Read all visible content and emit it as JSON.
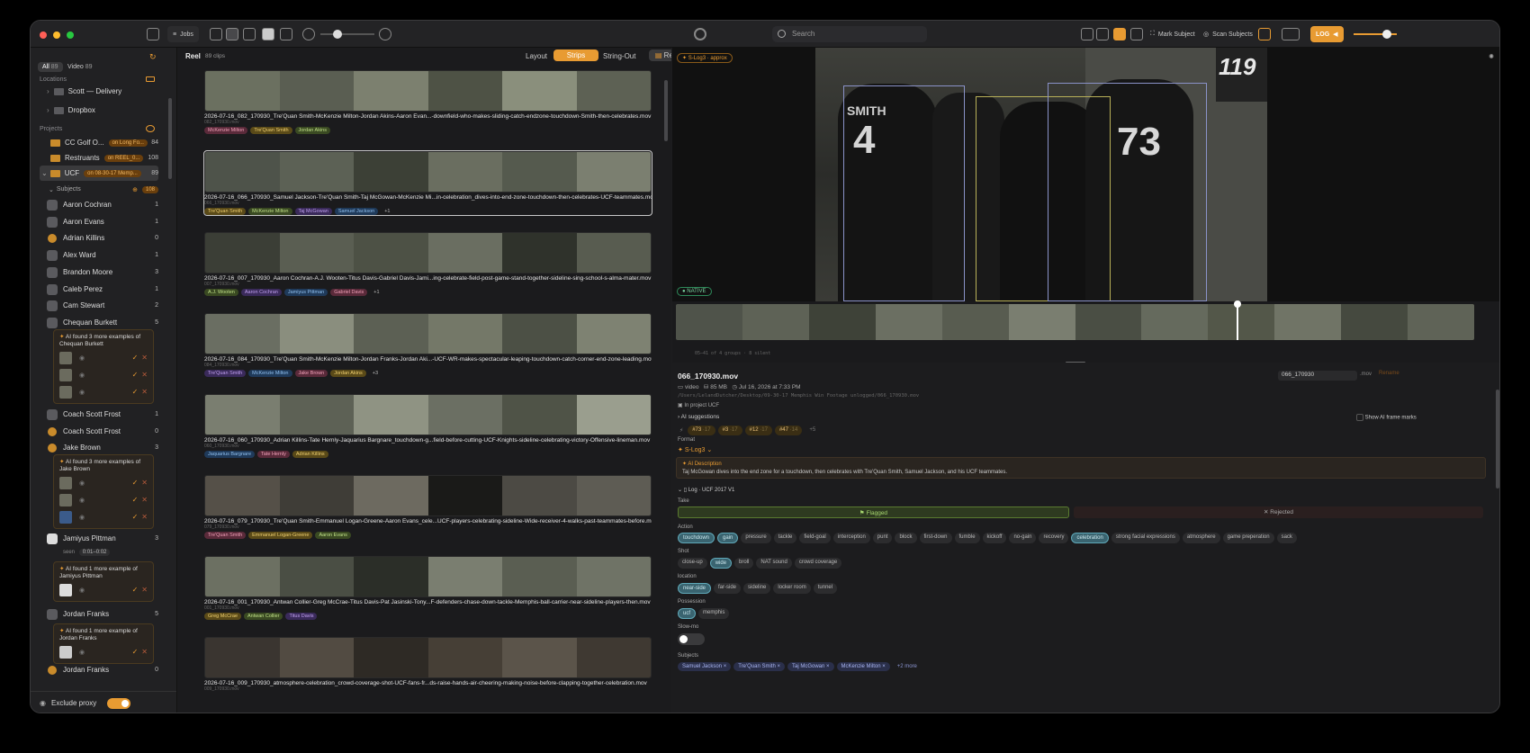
{
  "colors": {
    "accent": "#e89b32",
    "window_bg": "#1c1c1e",
    "sidebar_bg": "#212123",
    "selection_teal": "#3a6470"
  },
  "toolbar": {
    "jobs_label": "Jobs",
    "search_placeholder": "Search",
    "mark_subject_label": "Mark Subject",
    "scan_subjects_label": "Scan Subjects",
    "log_badge": "LOG",
    "icons": [
      "sidebar-toggle-icon",
      "jobs-icon",
      "grid-view-icon",
      "strip-view-icon",
      "doc-view-icon",
      "copy-icon",
      "clone-icon",
      "zoom-slider",
      "crosshair-icon",
      "search-icon",
      "monitor-icon",
      "loop-icon",
      "magic-icon",
      "wand-icon",
      "sort-icon",
      "keyboard-icon",
      "volume-icon"
    ]
  },
  "sidebar": {
    "filter_all": "All",
    "filter_all_count": "89",
    "filter_video": "Video",
    "filter_video_count": "89",
    "locations_title": "Locations",
    "locations": [
      {
        "label": "Scott — Delivery"
      },
      {
        "label": "Dropbox"
      }
    ],
    "projects_title": "Projects",
    "projects": [
      {
        "label": "CC Golf O...",
        "tag": "on Long Fo...",
        "count": "84"
      },
      {
        "label": "Restruants",
        "tag": "on REEL_0...",
        "count": "108"
      },
      {
        "label": "UCF",
        "tag": "on 08-30-17 Memp...",
        "count": "89"
      }
    ],
    "subjects_title": "Subjects",
    "subjects_count": "108",
    "subjects": [
      {
        "label": "Aaron Cochran",
        "count": "1"
      },
      {
        "label": "Aaron Evans",
        "count": "1"
      },
      {
        "label": "Adrian Killins",
        "count": "0"
      },
      {
        "label": "Alex Ward",
        "count": "1"
      },
      {
        "label": "Brandon Moore",
        "count": "3"
      },
      {
        "label": "Caleb Perez",
        "count": "1"
      },
      {
        "label": "Cam Stewart",
        "count": "2"
      },
      {
        "label": "Chequan Burkett",
        "count": "5"
      }
    ],
    "ai_chequan": "AI found 3 more examples of Chequan Burkett",
    "subjects2": [
      {
        "label": "Coach Scott Frost",
        "count": "1"
      },
      {
        "label": "Coach Scott Frost",
        "count": "0"
      },
      {
        "label": "Jake Brown",
        "count": "3"
      }
    ],
    "ai_jake": "AI found 3 more examples of Jake Brown",
    "jamiyus": {
      "label": "Jamiyus Pittman",
      "count": "3",
      "seen_label": "seen",
      "seen_value": "0:01–0:02"
    },
    "ai_jamiyus": "AI found 1 more example of Jamiyus Pittman",
    "jordan": {
      "label": "Jordan Franks",
      "count": "5"
    },
    "ai_jordan": "AI found 1 more example of Jordan Franks",
    "jordan2": {
      "label": "Jordan Franks",
      "count": "0"
    },
    "exclude_proxy": "Exclude proxy"
  },
  "reel": {
    "title": "Reel",
    "clip_count": "89 clips",
    "layout_label": "Layout",
    "modes": [
      "Strips",
      "String-Out",
      "Reel"
    ],
    "clips": [
      {
        "name": "2026-07-16_082_170930_Tre'Quan Smith-McKenzie Milton-Jordan Akins-Aaron Evan...-downfield-who-makes-sliding-catch-endzone-touchdown-Smith-then-celebrates.mov",
        "sub": "082_170930.mov",
        "tags": [
          "McKenzie Milton",
          "Tre'Quan Smith",
          "Jordan Akins"
        ],
        "more": ""
      },
      {
        "name": "2026-07-16_066_170930_Samuel Jackson-Tre'Quan Smith-Taj McGowan-McKenzie Mi...in-celebration_dives-into-end-zone-touchdown-then-celebrates-UCF-teammates.mov",
        "sub": "066_170930.mov",
        "tags": [
          "Tre'Quan Smith",
          "McKenzie Milton",
          "Taj McGowan",
          "Samuel Jackson"
        ],
        "more": "+1"
      },
      {
        "name": "2026-07-16_007_170930_Aaron Cochran-A.J. Wooten-Titus Davis-Gabriel Davis-Jami...ing-celebrate-field-post-game-stand-together-sideline-sing-school-s-alma-mater.mov",
        "sub": "007_170930.mov",
        "tags": [
          "A.J. Wooten",
          "Aaron Cochran",
          "Jamiyus Pittman",
          "Gabriel Davis"
        ],
        "more": "+1"
      },
      {
        "name": "2026-07-16_084_170930_Tre'Quan Smith-McKenzie Milton-Jordan Franks-Jordan Aki...-UCF-WR-makes-spectacular-leaping-touchdown-catch-corner-end-zone-leading.mov",
        "sub": "084_170930.mov",
        "tags": [
          "Tre'Quan Smith",
          "McKenzie Milton",
          "Jake Brown",
          "Jordan Akins"
        ],
        "more": "+3"
      },
      {
        "name": "2026-07-16_060_170930_Adrian Killins-Tate Hernly-Jaquarius Bargnare_touchdown-g...field-before-cutting-UCF-Knights-sideline-celebrating-victory-Offensive-lineman.mov",
        "sub": "060_170930.mov",
        "tags": [
          "Jaquarius Bargnare",
          "Tate Hernly",
          "Adrian Killins"
        ],
        "more": ""
      },
      {
        "name": "2026-07-16_079_170930_Tre'Quan Smith-Emmanuel Logan-Greene-Aaron Evans_cele...UCF-players-celebrating-sideline-Wide-receiver-4-walks-past-teammates-before.mov",
        "sub": "079_170930.mov",
        "tags": [
          "Tre'Quan Smith",
          "Emmanuel Logan-Greene",
          "Aaron Evans"
        ],
        "more": ""
      },
      {
        "name": "2026-07-16_001_170930_Antwan Collier-Greg McCrae-Titus Davis-Pat Jasinski-Tony...F-defenders-chase-down-tackle-Memphis-ball-carrier-near-sideline-players-then.mov",
        "sub": "001_170930.mov",
        "tags": [
          "Greg McCrae",
          "Antwan Collier",
          "Titus Davis"
        ],
        "more": ""
      },
      {
        "name": "2026-07-16_009_170930_atmosphere-celebration_crowd-coverage-shot-UCF-fans-fr...ds-raise-hands-air-cheering-making-noise-before-clapping-together-celebration.mov",
        "sub": "009_170930.mov",
        "tags": [],
        "more": ""
      }
    ]
  },
  "preview": {
    "badge_slog": "S-Log3 · approx",
    "badge_native": "NATIVE",
    "jersey_name_1": "SMITH",
    "jersey_number_1": "4",
    "jersey_number_2": "73",
    "jersey_number_3": "119",
    "scrub_info": "05–41 of 4 groups · 8 silent"
  },
  "inspector": {
    "filename": "066_170930.mov",
    "rename_value": "066_170930",
    "rename_ext": ".mov",
    "rename_button": "Rename",
    "kind": "video",
    "size": "85 MB",
    "date": "Jul 16, 2026 at 7:33 PM",
    "path": "/Users/LelandDutcher/Desktop/09-30-17 Memphis Win Footage unlogged/066_170930.mov",
    "in_project_label": "In project",
    "in_project_value": "UCF",
    "ai_suggestions": "AI suggestions",
    "show_frame_marks": "Show AI frame marks",
    "jerseys": [
      {
        "num": "#73",
        "conf": "·17"
      },
      {
        "num": "#3",
        "conf": "·17"
      },
      {
        "num": "#12",
        "conf": "·17"
      },
      {
        "num": "#47",
        "conf": "·14"
      }
    ],
    "jerseys_more": "+5",
    "format_label": "Format",
    "format_value": "S-Log3",
    "ai_desc_title": "AI Description",
    "ai_desc": "Taj McGowan dives into the end zone for a touchdown, then celebrates with Tre'Quan Smith, Samuel Jackson, and his UCF teammates.",
    "log_title": "Log · UCF 2017 V1",
    "take_label": "Take",
    "flagged": "Flagged",
    "rejected": "Rejected",
    "action_label": "Action",
    "action": [
      {
        "l": "touchdown",
        "on": true
      },
      {
        "l": "gain",
        "on": true
      },
      {
        "l": "pressure",
        "on": false
      },
      {
        "l": "tackle",
        "on": false
      },
      {
        "l": "field-goal",
        "on": false
      },
      {
        "l": "interception",
        "on": false
      },
      {
        "l": "punt",
        "on": false
      },
      {
        "l": "block",
        "on": false
      },
      {
        "l": "first-down",
        "on": false
      },
      {
        "l": "fumble",
        "on": false
      },
      {
        "l": "kickoff",
        "on": false
      },
      {
        "l": "no-gain",
        "on": false
      },
      {
        "l": "recovery",
        "on": false
      },
      {
        "l": "celebration",
        "on": true
      },
      {
        "l": "strong facial expressions",
        "on": false
      },
      {
        "l": "atmosphere",
        "on": false
      },
      {
        "l": "game preperation",
        "on": false
      },
      {
        "l": "sack",
        "on": false
      }
    ],
    "shot_label": "Shot",
    "shot": [
      {
        "l": "close-up",
        "on": false
      },
      {
        "l": "wide",
        "on": true
      },
      {
        "l": "broll",
        "on": false
      },
      {
        "l": "NAT sound",
        "on": false
      },
      {
        "l": "crowd coverage",
        "on": false
      }
    ],
    "location_label": "location",
    "location": [
      {
        "l": "near-side",
        "on": true
      },
      {
        "l": "far-side",
        "on": false
      },
      {
        "l": "sideline",
        "on": false
      },
      {
        "l": "locker room",
        "on": false
      },
      {
        "l": "tunnel",
        "on": false
      }
    ],
    "possession_label": "Possession",
    "possession": [
      {
        "l": "ucf",
        "on": true
      },
      {
        "l": "memphis",
        "on": false
      }
    ],
    "slowmo_label": "Slow-mo",
    "subjects_label": "Subjects",
    "subjects": [
      "Samuel Jackson",
      "Tre'Quan Smith",
      "Taj McGowan",
      "McKenzie Milton"
    ],
    "subjects_more": "+2 more"
  }
}
